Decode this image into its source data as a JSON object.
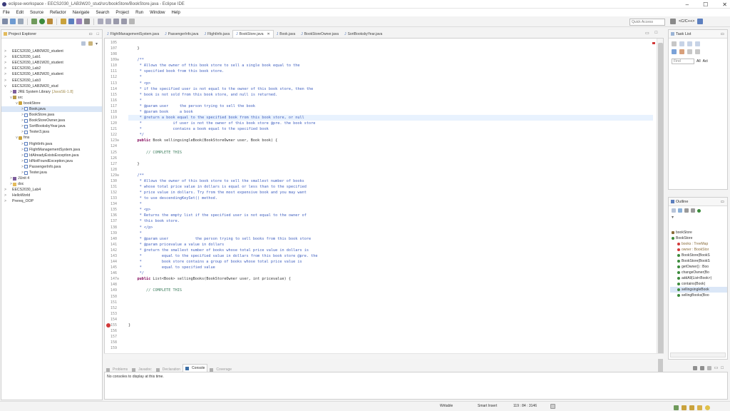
{
  "window": {
    "title": "eclipse-workspace - EECS2030_LAB3W20_stud/src/bookStore/BookStore.java - Eclipse IDE",
    "controls": [
      "–",
      "☐",
      "✕"
    ]
  },
  "menu": [
    "File",
    "Edit",
    "Source",
    "Refactor",
    "Navigate",
    "Search",
    "Project",
    "Run",
    "Window",
    "Help"
  ],
  "toolbar": {
    "quick_access_placeholder": "Quick Access",
    "perspective_label": "<C/C++>"
  },
  "project_explorer": {
    "title": "Project Explorer",
    "items": [
      {
        "label": "EECS2030_LAB0W20_student",
        "indent": 0,
        "twisty": ">",
        "icon": "project"
      },
      {
        "label": "EECS2030_Lab1",
        "indent": 0,
        "twisty": ">",
        "icon": "project"
      },
      {
        "label": "EECS2030_LAB1W20_student",
        "indent": 0,
        "twisty": ">",
        "icon": "project"
      },
      {
        "label": "EECS2030_Lab2",
        "indent": 0,
        "twisty": ">",
        "icon": "project"
      },
      {
        "label": "EECS2030_LAB2W20_student",
        "indent": 0,
        "twisty": ">",
        "icon": "project"
      },
      {
        "label": "EECS2030_Lab3",
        "indent": 0,
        "twisty": ">",
        "icon": "project"
      },
      {
        "label": "EECS2030_LAB3W20_stud",
        "indent": 0,
        "twisty": "v",
        "icon": "project"
      },
      {
        "label": "JRE System Library",
        "suffix": "[JavaSE-1.8]",
        "indent": 1,
        "twisty": ">",
        "icon": "lib"
      },
      {
        "label": "src",
        "indent": 1,
        "twisty": "v",
        "icon": "src"
      },
      {
        "label": "bookStore",
        "indent": 2,
        "twisty": "v",
        "icon": "pkg"
      },
      {
        "label": "Book.java",
        "indent": 3,
        "twisty": ">",
        "icon": "java",
        "selected": true
      },
      {
        "label": "BookStore.java",
        "indent": 3,
        "twisty": ">",
        "icon": "java"
      },
      {
        "label": "BookStoreOwner.java",
        "indent": 3,
        "twisty": ">",
        "icon": "java"
      },
      {
        "label": "SortBooksbyYear.java",
        "indent": 3,
        "twisty": ">",
        "icon": "java"
      },
      {
        "label": "Tester3.java",
        "indent": 3,
        "twisty": ">",
        "icon": "java"
      },
      {
        "label": "fms",
        "indent": 2,
        "twisty": "v",
        "icon": "pkg"
      },
      {
        "label": "FlightInfo.java",
        "indent": 3,
        "twisty": ">",
        "icon": "java"
      },
      {
        "label": "FlightManagementSystem.java",
        "indent": 3,
        "twisty": ">",
        "icon": "java"
      },
      {
        "label": "IdAlreadyExistsException.java",
        "indent": 3,
        "twisty": ">",
        "icon": "java"
      },
      {
        "label": "IdNotFoundException.java",
        "indent": 3,
        "twisty": ">",
        "icon": "java"
      },
      {
        "label": "PassengerInfo.java",
        "indent": 3,
        "twisty": ">",
        "icon": "java"
      },
      {
        "label": "Tester.java",
        "indent": 3,
        "twisty": ">",
        "icon": "java"
      },
      {
        "label": "JUnit 4",
        "indent": 1,
        "twisty": ">",
        "icon": "lib"
      },
      {
        "label": "doc",
        "indent": 1,
        "twisty": ">",
        "icon": "folder"
      },
      {
        "label": "EECS2030_Lab4",
        "indent": 0,
        "twisty": ">",
        "icon": "project"
      },
      {
        "label": "HelloWorld",
        "indent": 0,
        "twisty": ">",
        "icon": "project"
      },
      {
        "label": "Prereq_OOP",
        "indent": 0,
        "twisty": ">",
        "icon": "project"
      }
    ]
  },
  "editor": {
    "tabs": [
      {
        "label": "FlightManagementSystem.java",
        "active": false
      },
      {
        "label": "PassengerInfo.java",
        "active": false
      },
      {
        "label": "FlightInfo.java",
        "active": false
      },
      {
        "label": "BookStore.java",
        "active": true
      },
      {
        "label": "Book.java",
        "active": false
      },
      {
        "label": "BookStoreOwner.java",
        "active": false
      },
      {
        "label": "SortBooksbyYear.java",
        "active": false
      }
    ],
    "lines": [
      {
        "n": "105",
        "t": "",
        "c": "plain"
      },
      {
        "n": "107",
        "t": "    }",
        "c": "plain"
      },
      {
        "n": "108",
        "t": "",
        "c": "plain"
      },
      {
        "n": "109⊖",
        "t": "    /**",
        "c": "jd"
      },
      {
        "n": "110",
        "t": "     * Allows the owner of this book store to sell a single book equal to the",
        "c": "jd"
      },
      {
        "n": "111",
        "t": "     * specified book from this book store.",
        "c": "jd"
      },
      {
        "n": "112",
        "t": "     *",
        "c": "jd"
      },
      {
        "n": "113",
        "t": "     * <p>",
        "c": "jd"
      },
      {
        "n": "114",
        "t": "     * if the specified user is not equal to the owner of this book store, then the",
        "c": "jd"
      },
      {
        "n": "115",
        "t": "     * book is not sold from this book store, and null is returned.",
        "c": "jd"
      },
      {
        "n": "116",
        "t": "     *",
        "c": "jd"
      },
      {
        "n": "117",
        "t": "     * @param user     the person trying to sell the book",
        "c": "jd"
      },
      {
        "n": "118",
        "t": "     * @param book     a book",
        "c": "jd"
      },
      {
        "n": "119",
        "t": "     * @return a book equal to the specified book from this book store, or null",
        "c": "jd",
        "current": true
      },
      {
        "n": "120",
        "t": "     *              if user is not the owner of this book store @pre. the book store",
        "c": "jd"
      },
      {
        "n": "121",
        "t": "     *              contains a book equal to the specified book",
        "c": "jd"
      },
      {
        "n": "122",
        "t": "     */",
        "c": "jd"
      },
      {
        "n": "123⊖",
        "t": "    public Book sellingsingleBook(BookStoreOwner user, Book book) {",
        "c": "code"
      },
      {
        "n": "124",
        "t": "",
        "c": "plain"
      },
      {
        "n": "125",
        "t": "        // COMPLETE THIS",
        "c": "cm"
      },
      {
        "n": "126",
        "t": "",
        "c": "plain"
      },
      {
        "n": "127",
        "t": "    }",
        "c": "plain"
      },
      {
        "n": "128",
        "t": "",
        "c": "plain"
      },
      {
        "n": "129⊖",
        "t": "    /**",
        "c": "jd"
      },
      {
        "n": "130",
        "t": "     * Allows the owner of this book store to sell the smallest number of books",
        "c": "jd"
      },
      {
        "n": "131",
        "t": "     * whose total price value in dollars is equal or less than to the specified",
        "c": "jd"
      },
      {
        "n": "132",
        "t": "     * price value in dollars. Try from the most expensive book and you may want",
        "c": "jd"
      },
      {
        "n": "133",
        "t": "     * to use descendingKeySet() method.",
        "c": "jd"
      },
      {
        "n": "134",
        "t": "     *",
        "c": "jd"
      },
      {
        "n": "135",
        "t": "     * <p>",
        "c": "jd"
      },
      {
        "n": "136",
        "t": "     * Returns the empty list if the specified user is not equal to the owner of",
        "c": "jd"
      },
      {
        "n": "137",
        "t": "     * this book store.",
        "c": "jd"
      },
      {
        "n": "138",
        "t": "     * </p>",
        "c": "jd"
      },
      {
        "n": "139",
        "t": "     *",
        "c": "jd"
      },
      {
        "n": "140",
        "t": "     * @param user            the person trying to sell books from this book store",
        "c": "jd"
      },
      {
        "n": "141",
        "t": "     * @param pricevalue a value in dollars",
        "c": "jd"
      },
      {
        "n": "142",
        "t": "     * @return the smallest number of books whose total price value in dollars is",
        "c": "jd"
      },
      {
        "n": "143",
        "t": "     *         equal to the specified value in dollars from this book store @pre. the",
        "c": "jd"
      },
      {
        "n": "144",
        "t": "     *         book store contains a group of books whose total price value is",
        "c": "jd"
      },
      {
        "n": "145",
        "t": "     *         equal to specified value",
        "c": "jd"
      },
      {
        "n": "146",
        "t": "     */",
        "c": "jd"
      },
      {
        "n": "147⊖",
        "t": "    public List<Book> sellingBooks(BookStoreOwner user, int pricevalue) {",
        "c": "code"
      },
      {
        "n": "148",
        "t": "",
        "c": "plain"
      },
      {
        "n": "149",
        "t": "        // COMPLETE THIS",
        "c": "cm"
      },
      {
        "n": "150",
        "t": "",
        "c": "plain"
      },
      {
        "n": "151",
        "t": "",
        "c": "plain"
      },
      {
        "n": "152",
        "t": "",
        "c": "plain"
      },
      {
        "n": "153",
        "t": "",
        "c": "plain"
      },
      {
        "n": "154",
        "t": "",
        "c": "plain"
      },
      {
        "n": "155",
        "t": "}",
        "c": "plain",
        "error": true
      },
      {
        "n": "156",
        "t": "",
        "c": "plain"
      },
      {
        "n": "157",
        "t": "",
        "c": "plain"
      },
      {
        "n": "158",
        "t": "",
        "c": "plain"
      },
      {
        "n": "159",
        "t": "",
        "c": "plain"
      }
    ]
  },
  "task_list": {
    "title": "Task List",
    "find_placeholder": "Find",
    "all_label": "All",
    "activate_label": "Act"
  },
  "outline": {
    "title": "Outline",
    "items": [
      {
        "label": "bookStore",
        "kind": "package"
      },
      {
        "label": "BookStore",
        "kind": "class"
      },
      {
        "label": "books : TreeMap",
        "kind": "field-private"
      },
      {
        "label": "owner : BookStor",
        "kind": "field-private"
      },
      {
        "label": "BookStore(BookS",
        "kind": "ctor"
      },
      {
        "label": "BookStore(BookS",
        "kind": "ctor"
      },
      {
        "label": "getOwner() : Boo",
        "kind": "method"
      },
      {
        "label": "changeOwner(Bo",
        "kind": "method"
      },
      {
        "label": "addAll(List<Book>)",
        "kind": "method"
      },
      {
        "label": "contains(Book)",
        "kind": "method"
      },
      {
        "label": "sellingsingleBook",
        "kind": "method",
        "selected": true
      },
      {
        "label": "sellingBooks(Boo",
        "kind": "method"
      }
    ]
  },
  "bottom": {
    "tabs": [
      {
        "label": "Problems",
        "active": false
      },
      {
        "label": "Javadoc",
        "active": false
      },
      {
        "label": "Declaration",
        "active": false
      },
      {
        "label": "Console",
        "active": true
      },
      {
        "label": "Coverage",
        "active": false
      }
    ],
    "console_message": "No consoles to display at this time."
  },
  "status_bar": {
    "writable": "Writable",
    "insert_mode": "Smart Insert",
    "position": "119 : 84 : 3146"
  },
  "colors": {
    "javadoc": "#3f5fbf",
    "keyword": "#7f0055",
    "comment": "#3f7f5f",
    "current_line": "#e8f2fe",
    "selection": "#dbe7f7"
  }
}
